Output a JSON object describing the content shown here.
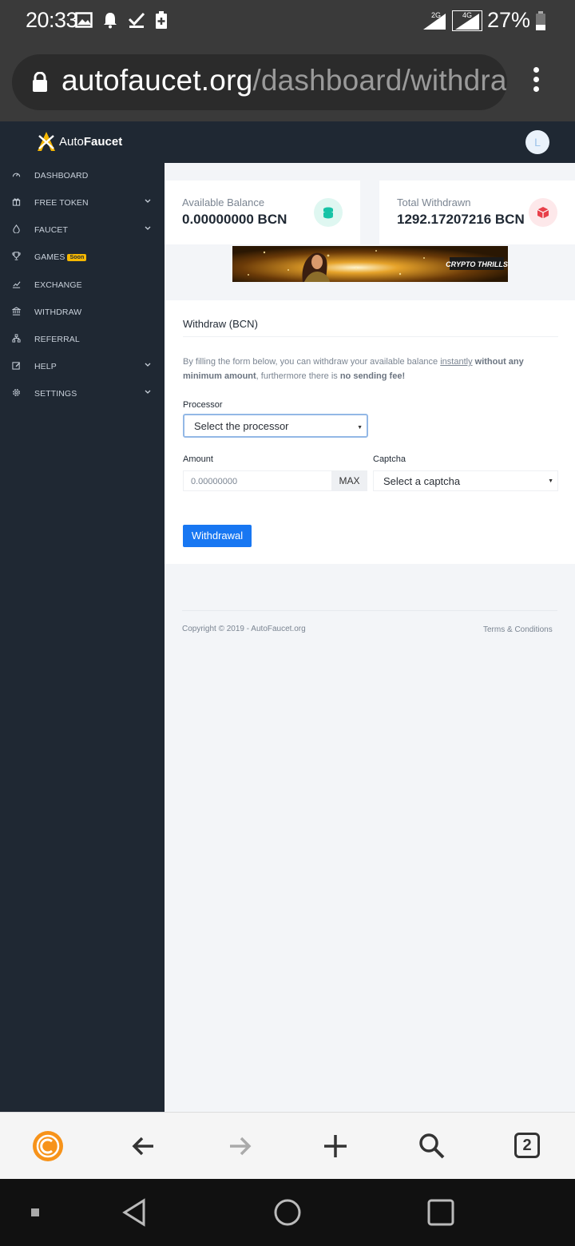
{
  "status_bar": {
    "time": "20:33",
    "signal_1": "2G",
    "signal_2": "4G",
    "battery": "27%"
  },
  "browser": {
    "url_domain": "autofaucet.org",
    "url_path": "/dashboard/withdraw/B",
    "tab_count": "2"
  },
  "app": {
    "brand_light": "Auto",
    "brand_bold": "Faucet",
    "avatar_letter": "L"
  },
  "sidebar": {
    "items": [
      {
        "label": "DASHBOARD",
        "icon": "dashboard-icon",
        "has_chevron": false
      },
      {
        "label": "FREE TOKEN",
        "icon": "gift-icon",
        "has_chevron": true
      },
      {
        "label": "FAUCET",
        "icon": "drop-icon",
        "has_chevron": true
      },
      {
        "label": "GAMES",
        "icon": "trophy-icon",
        "has_chevron": false,
        "badge": "Soon"
      },
      {
        "label": "EXCHANGE",
        "icon": "chart-icon",
        "has_chevron": false
      },
      {
        "label": "WITHDRAW",
        "icon": "bank-icon",
        "has_chevron": false
      },
      {
        "label": "REFERRAL",
        "icon": "network-icon",
        "has_chevron": false
      },
      {
        "label": "HELP",
        "icon": "edit-icon",
        "has_chevron": true
      },
      {
        "label": "SETTINGS",
        "icon": "gear-icon",
        "has_chevron": true
      }
    ]
  },
  "stats": {
    "available_label": "Available Balance",
    "available_value": "0.00000000 BCN",
    "withdrawn_label": "Total Withdrawn",
    "withdrawn_value": "1292.17207216 BCN"
  },
  "banner": {
    "text": "CRYPTO THRILLS"
  },
  "withdraw": {
    "title": "Withdraw (BCN)",
    "desc_1": "By filling the form below, you can withdraw your available balance ",
    "desc_instantly": "instantly",
    "desc_2": " ",
    "desc_bold_1": "without any minimum amount",
    "desc_3": ", furthermore there is ",
    "desc_bold_2": "no sending fee!",
    "processor_label": "Processor",
    "processor_value": "Select the processor",
    "amount_label": "Amount",
    "amount_value": "0.00000000",
    "max_label": "MAX",
    "captcha_label": "Captcha",
    "captcha_value": "Select a captcha",
    "submit_label": "Withdrawal"
  },
  "footer": {
    "copyright": "Copyright © 2019 - AutoFaucet.org",
    "terms": "Terms & Conditions"
  },
  "colors": {
    "sidebar_bg": "#1f2833",
    "accent_blue": "#1877f2",
    "green_icon": "#17c3a6",
    "red_icon": "#e8404a",
    "badge": "#f5b700"
  }
}
